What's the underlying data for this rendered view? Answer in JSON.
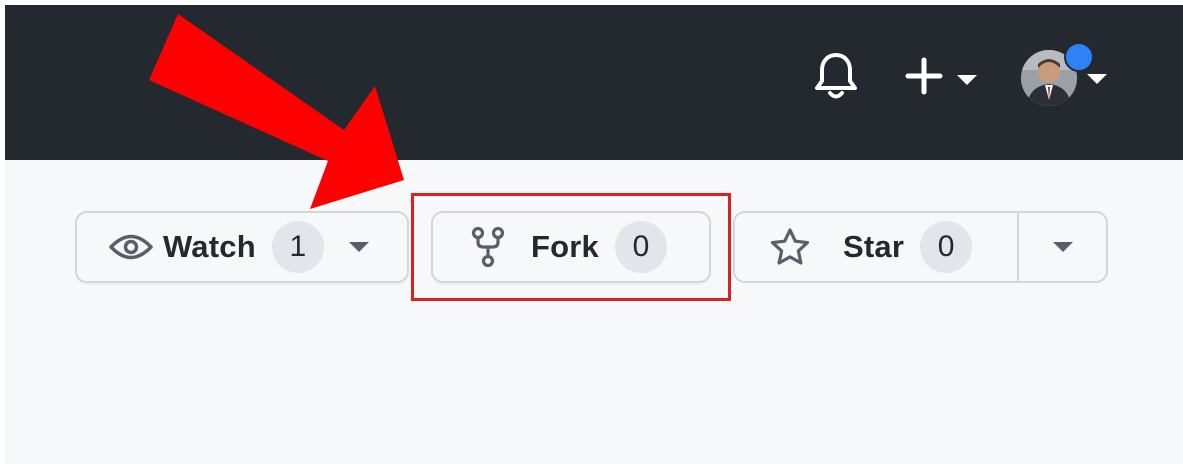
{
  "header": {
    "notifications_icon": "bell-icon",
    "create_icon": "plus-icon",
    "create_menu_icon": "caret-down-icon",
    "avatar_alt": "user-avatar",
    "avatar_menu_icon": "caret-down-icon",
    "status_dot_color": "#2f81f7",
    "background": "#24292f"
  },
  "repo_actions": {
    "watch": {
      "icon": "eye-icon",
      "label": "Watch",
      "count": "1",
      "menu_icon": "caret-down-icon"
    },
    "fork": {
      "icon": "repo-forked-icon",
      "label": "Fork",
      "count": "0"
    },
    "star": {
      "icon": "star-icon",
      "label": "Star",
      "count": "0",
      "menu_icon": "caret-down-icon"
    }
  },
  "annotation": {
    "highlight_color": "#e01e1e",
    "arrow_color": "#ff0000",
    "highlighted": "fork"
  }
}
